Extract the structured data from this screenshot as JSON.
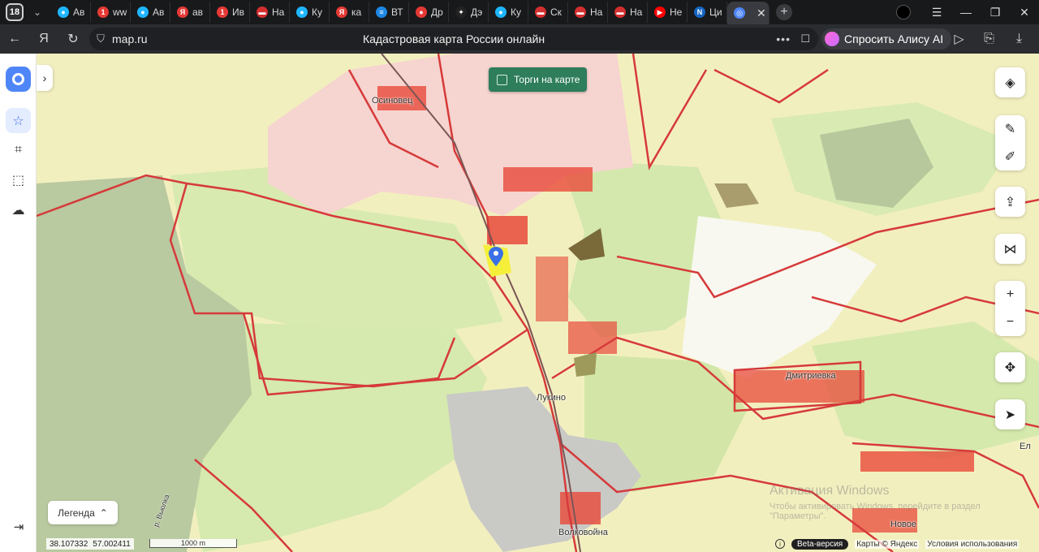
{
  "browser": {
    "tab_count": "18",
    "tabs": [
      {
        "label": "Ав",
        "color": "#1fb6ff",
        "glyph": "●"
      },
      {
        "label": "ww",
        "color": "#e53935",
        "glyph": "1"
      },
      {
        "label": "Ав",
        "color": "#1fb6ff",
        "glyph": "●"
      },
      {
        "label": "ав",
        "color": "#e53935",
        "glyph": "Я"
      },
      {
        "label": "Ив",
        "color": "#e53935",
        "glyph": "1"
      },
      {
        "label": "На",
        "color": "#d32f2f",
        "glyph": "▬"
      },
      {
        "label": "Ку",
        "color": "#1fb6ff",
        "glyph": "●"
      },
      {
        "label": "ка",
        "color": "#e53935",
        "glyph": "Я"
      },
      {
        "label": "ВТ",
        "color": "#1e88e5",
        "glyph": "≡"
      },
      {
        "label": "Др",
        "color": "#e53935",
        "glyph": "●"
      },
      {
        "label": "Дэ",
        "color": "#222222",
        "glyph": "✦"
      },
      {
        "label": "Ку",
        "color": "#1fb6ff",
        "glyph": "●"
      },
      {
        "label": "Ск",
        "color": "#d32f2f",
        "glyph": "▬"
      },
      {
        "label": "На",
        "color": "#d32f2f",
        "glyph": "▬"
      },
      {
        "label": "На",
        "color": "#d32f2f",
        "glyph": "▬"
      },
      {
        "label": "Не",
        "color": "#ff0000",
        "glyph": "▶"
      },
      {
        "label": "Ци",
        "color": "#1565c0",
        "glyph": "N"
      },
      {
        "label": "",
        "color": "#4f86f7",
        "glyph": "◎"
      }
    ],
    "address": "map.ru",
    "page_title": "Кадастровая карта России онлайн",
    "alice_label": "Спросить Алису AI"
  },
  "map": {
    "torgi_label": "Торги на карте",
    "legend_label": "Легенда",
    "coords": {
      "lon": "38.107332",
      "lat": "57.002411"
    },
    "scale_label": "1000 m",
    "footer": {
      "beta": "Beta-версия",
      "attribution": "Карты © Яндекс",
      "terms": "Условия использования"
    },
    "places": [
      {
        "name": "Осиновец"
      },
      {
        "name": "Лукино"
      },
      {
        "name": "Волковойна"
      },
      {
        "name": "Дмитриевка"
      },
      {
        "name": "Новое"
      },
      {
        "name": "Ел"
      },
      {
        "name": "р. Вьюлка"
      }
    ]
  },
  "watermark": {
    "title": "Активация Windows",
    "subtitle": "Чтобы активировать Windows, перейдите в раздел \"Параметры\"."
  },
  "colors": {
    "torgi_bg": "#2e7d5b",
    "parcel_border": "#d63a3a",
    "accent": "#4f86f7"
  }
}
